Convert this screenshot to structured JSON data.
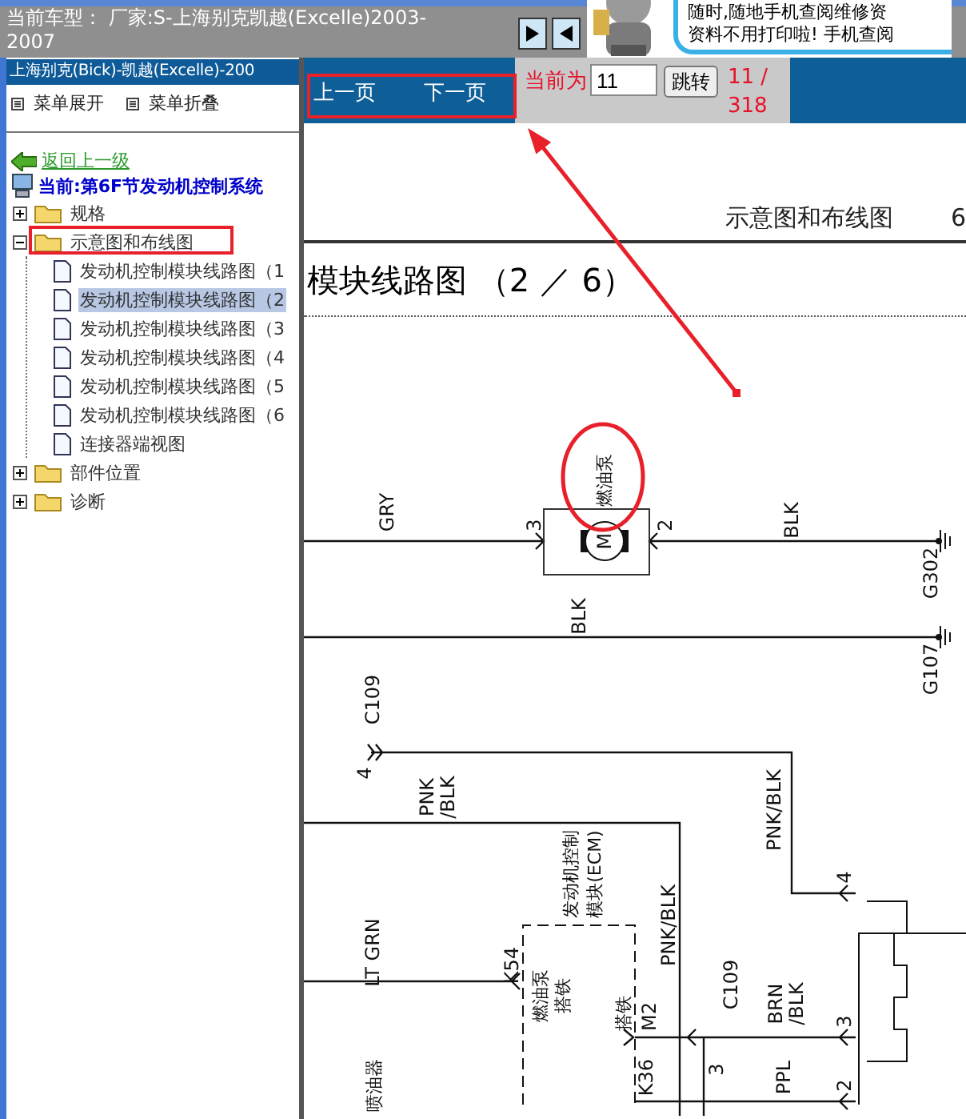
{
  "header": {
    "vehicle_label": "当前车型：",
    "vehicle_value": "厂家:S-上海别克凯越(Excelle)2003-2007"
  },
  "ad": {
    "lines": [
      "随时,随地手机查阅维修资",
      "资料不用打印啦! 手机查阅"
    ]
  },
  "sidebar": {
    "title": "上海别克(Bick)-凯越(Excelle)-200",
    "menu": [
      "菜单展开",
      "菜单折叠"
    ],
    "back_link": "返回上一级",
    "current": "当前:第6F节发动机控制系统",
    "tree": [
      {
        "label": "规格",
        "expanded": false
      },
      {
        "label": "示意图和布线图",
        "expanded": true,
        "children": [
          {
            "label": "发动机控制模块线路图（1",
            "selected": false
          },
          {
            "label": "发动机控制模块线路图（2",
            "selected": true
          },
          {
            "label": "发动机控制模块线路图（3",
            "selected": false
          },
          {
            "label": "发动机控制模块线路图（4",
            "selected": false
          },
          {
            "label": "发动机控制模块线路图（5",
            "selected": false
          },
          {
            "label": "发动机控制模块线路图（6",
            "selected": false
          },
          {
            "label": "连接器端视图",
            "selected": false
          }
        ]
      },
      {
        "label": "部件位置",
        "expanded": false
      },
      {
        "label": "诊断",
        "expanded": false
      }
    ]
  },
  "toolbar": {
    "prev": "上一页",
    "next": "下一页",
    "current_label": "当前为",
    "page_value": "11",
    "jump_button": "跳转",
    "page_count": "11 / 318"
  },
  "document": {
    "section": "示意图和布线图",
    "section_code": "6",
    "title": "模块线路图 （2 ／ 6）",
    "labels": [
      {
        "text": "燃油泵"
      },
      {
        "text": "M"
      },
      {
        "text": "GRY"
      },
      {
        "text": "3"
      },
      {
        "text": "2"
      },
      {
        "text": "BLK"
      },
      {
        "text": "G302"
      },
      {
        "text": "BLK"
      },
      {
        "text": "G107"
      },
      {
        "text": "C109"
      },
      {
        "text": "4"
      },
      {
        "text": "PNK"
      },
      {
        "text": "/BLK"
      },
      {
        "text": "PNK/BLK"
      },
      {
        "text": "发动机控制"
      },
      {
        "text": "模块(ECM)"
      },
      {
        "text": "PNK/BLK"
      },
      {
        "text": "LT GRN"
      },
      {
        "text": "K54"
      },
      {
        "text": "燃油泵"
      },
      {
        "text": "搭铁"
      },
      {
        "text": "4"
      },
      {
        "text": "M2"
      },
      {
        "text": "搭铁"
      },
      {
        "text": "C109"
      },
      {
        "text": "BRN"
      },
      {
        "text": "/BLK"
      },
      {
        "text": "3"
      },
      {
        "text": "3"
      },
      {
        "text": "K36"
      },
      {
        "text": "PPL"
      },
      {
        "text": "2"
      },
      {
        "text": "喷油器"
      }
    ]
  }
}
